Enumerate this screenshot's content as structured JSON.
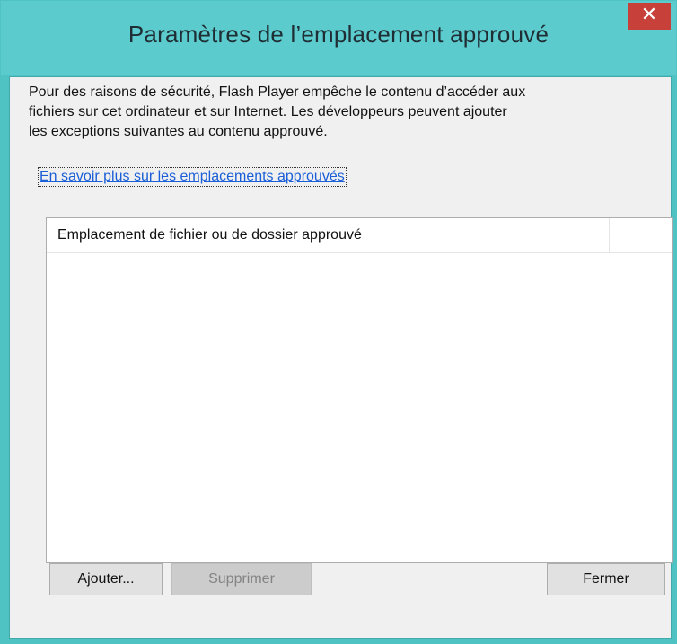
{
  "window": {
    "title": "Paramètres de l’emplacement approuvé",
    "close_glyph": "✕"
  },
  "description": {
    "line1": "Pour des raisons de sécurité, Flash Player empêche le contenu d’accéder aux",
    "line2": "fichiers sur cet ordinateur et sur Internet. Les développeurs peuvent ajouter",
    "line3": "les exceptions suivantes au contenu approuvé."
  },
  "learn_more_link": "En savoir plus sur les emplacements approuvés",
  "list": {
    "column_header": "Emplacement de fichier ou de dossier approuvé",
    "rows": []
  },
  "buttons": {
    "add": "Ajouter...",
    "remove": "Supprimer",
    "close": "Fermer"
  },
  "colors": {
    "titlebar": "#5ccbcd",
    "close_button": "#c8403a",
    "link": "#1a5fd7"
  },
  "icons": {
    "close": "close-icon"
  }
}
